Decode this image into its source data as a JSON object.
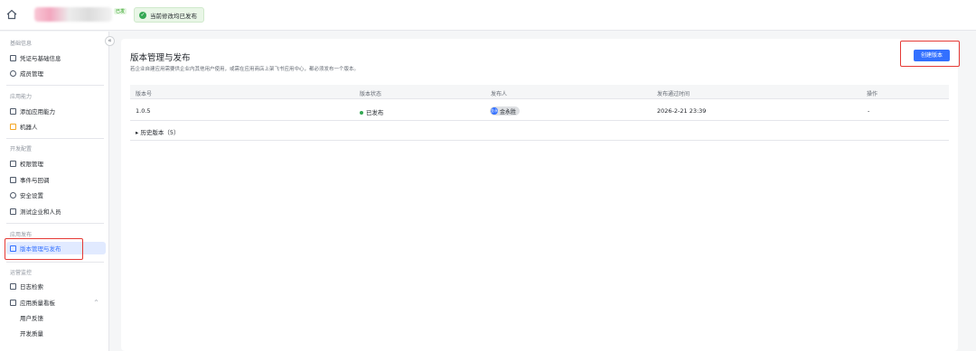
{
  "topbar": {
    "app_tag": "已发",
    "status_text": "当前修改均已发布"
  },
  "sidebar": {
    "collapse": "«",
    "sections": {
      "basic": "基础信息",
      "ability": "应用能力",
      "dev": "开发配置",
      "release": "应用发布",
      "ops": "运营监控"
    },
    "items": {
      "credentials": "凭证与基础信息",
      "members": "成员管理",
      "add_ability": "添加应用能力",
      "bot": "机器人",
      "permissions": "权限管理",
      "events": "事件与回调",
      "security": "安全设置",
      "test_enterprise": "测试企业和人员",
      "version_release": "版本管理与发布",
      "log_search": "日志检索",
      "quality_board": "应用质量看板",
      "user_feedback": "用户反馈",
      "dev_quality": "开发质量"
    }
  },
  "main": {
    "title": "版本管理与发布",
    "description": "若企业自建应用需要供企业内其他用户使用，或需在应用商店上架飞书应用中心，都必须发布一个版本。",
    "create_button": "创建版本",
    "columns": {
      "version": "版本号",
      "status": "版本状态",
      "publisher": "发布人",
      "approved_time": "发布通过时间",
      "actions": "操作"
    },
    "rows": [
      {
        "version": "1.0.5",
        "status": "已发布",
        "publisher": "金永胜",
        "avatar": "金永",
        "approved_time": "2026-2-21 23:39",
        "actions": "-"
      }
    ],
    "history": "历史版本（5）"
  },
  "colors": {
    "accent": "#3370ff",
    "success": "#34a853",
    "highlight": "#e53935"
  }
}
